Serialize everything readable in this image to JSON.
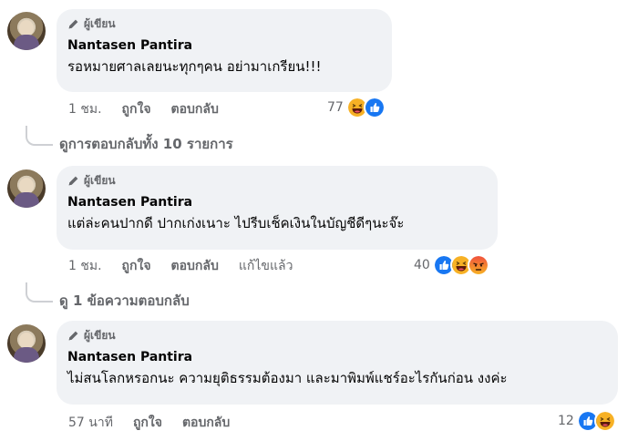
{
  "comments": [
    {
      "badge": "ผู้เขียน",
      "author": "Nantasen Pantira",
      "text": "รอหมายศาลเลยนะทุกๆคน อย่ามาเกรียน!!!",
      "time": "1 ชม.",
      "like": "ถูกใจ",
      "reply": "ตอบกลับ",
      "reaction_count": "77",
      "reactions": [
        "haha-icon",
        "like-icon"
      ],
      "replies_link": "ดูการตอบกลับทั้ง 10 รายการ"
    },
    {
      "badge": "ผู้เขียน",
      "author": "Nantasen Pantira",
      "text": "แต่ล่ะคนปากดี ปากเก่งเนาะ ไปรีบเช็คเงินในบัญชีดีๆนะจ๊ะ",
      "time": "1 ชม.",
      "like": "ถูกใจ",
      "reply": "ตอบกลับ",
      "edited": "แก้ไขแล้ว",
      "reaction_count": "40",
      "reactions": [
        "like-icon",
        "haha-icon",
        "angry-icon"
      ],
      "replies_link": "ดู 1 ข้อความตอบกลับ"
    },
    {
      "badge": "ผู้เขียน",
      "author": "Nantasen Pantira",
      "text": "ไม่สนโลกหรอกนะ ความยุติธรรมต้องมา และมาพิมพ์แชร์อะไรกันก่อน งงค่ะ",
      "time": "57 นาที",
      "like": "ถูกใจ",
      "reply": "ตอบกลับ",
      "reaction_count": "12",
      "reactions": [
        "like-icon",
        "haha-icon"
      ]
    }
  ],
  "colors": {
    "bubble": "#f0f2f5",
    "like": "#1877f2",
    "haha": "#f7b125",
    "angry": "#e9710f",
    "meta": "#65676b"
  }
}
